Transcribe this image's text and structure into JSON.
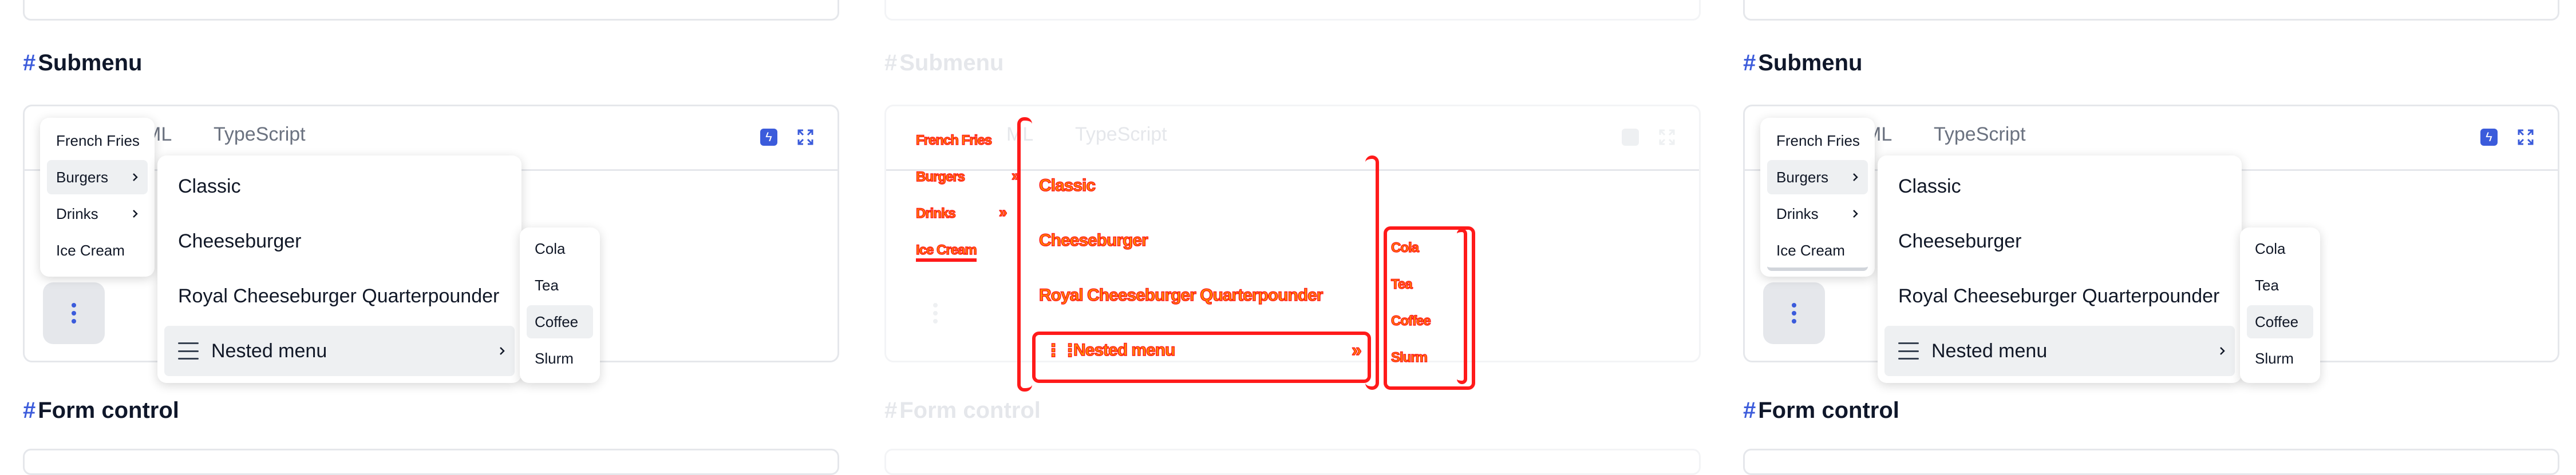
{
  "section_submenu": "Submenu",
  "section_form_control": "Form control",
  "hash": "#",
  "tabs": {
    "html_partial": "ML",
    "typescript": "TypeScript"
  },
  "menu_level1": [
    "French Fries",
    "Burgers",
    "Drinks",
    "Ice Cream"
  ],
  "menu_level2": [
    "Classic",
    "Cheeseburger",
    "Royal Cheeseburger Quarterpounder",
    "Nested menu"
  ],
  "menu_level3": [
    "Cola",
    "Tea",
    "Coffee",
    "Slurm"
  ],
  "icons": {
    "bolt": "bolt-icon",
    "expand": "expand-icon",
    "kebab": "kebab-icon",
    "chevron": "chevron-right-icon",
    "hamburger": "hamburger-icon"
  },
  "colors": {
    "accent": "#3b5bdb",
    "highlight": "#eef0f2",
    "debug_red": "#ff1a1a",
    "debug_orange": "#ff8c00"
  }
}
